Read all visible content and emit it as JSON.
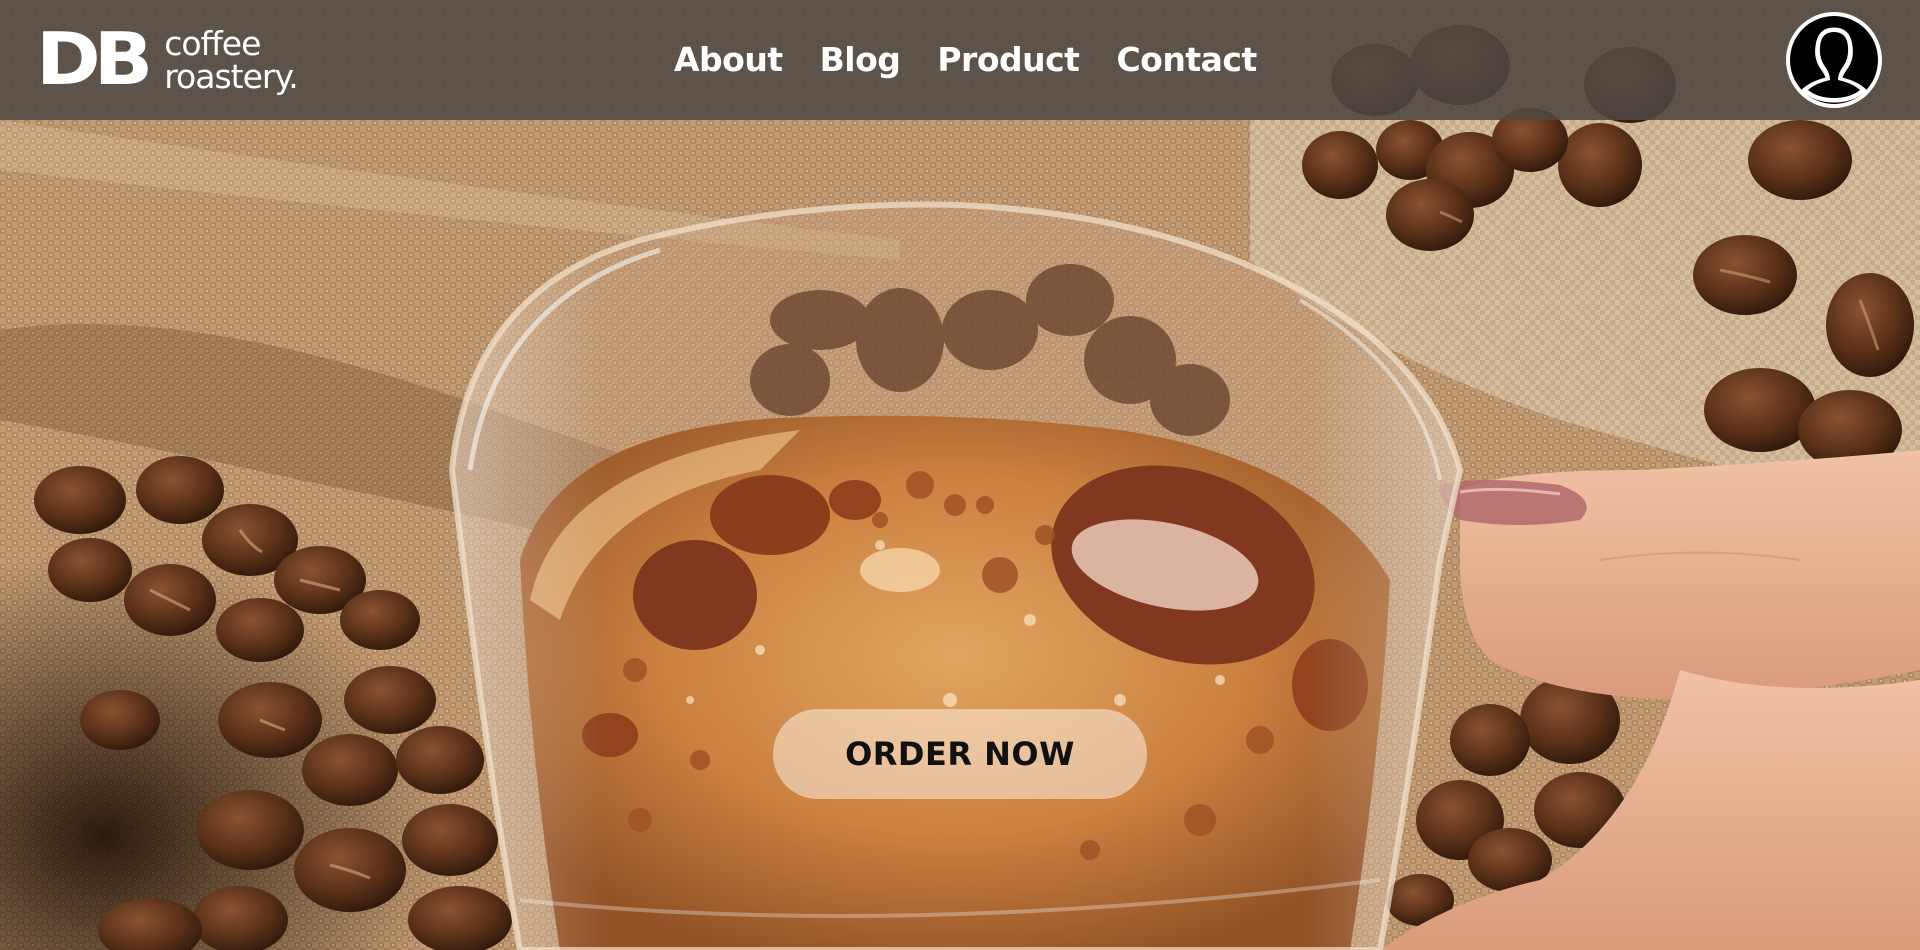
{
  "header": {
    "logo": {
      "mark": "DB",
      "line1": "coffee",
      "line2": "roastery."
    },
    "nav": [
      {
        "label": "About"
      },
      {
        "label": "Blog"
      },
      {
        "label": "Product"
      },
      {
        "label": "Contact"
      }
    ],
    "avatar_icon": "user-silhouette-icon"
  },
  "hero": {
    "cta_label": "ORDER NOW"
  },
  "colors": {
    "header_bg": "#4e4844",
    "text": "#ffffff",
    "cta_text": "#111111",
    "coffee": "#b8692a",
    "burlap": "#b7916a",
    "bean": "#4a2814"
  }
}
